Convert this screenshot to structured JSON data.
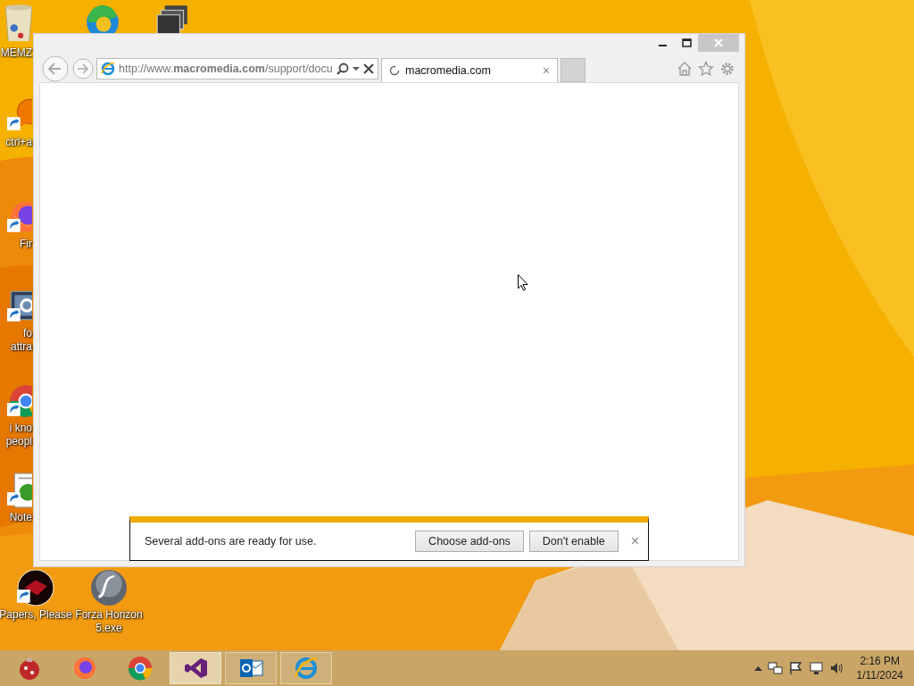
{
  "desktop_icons": [
    {
      "kind": "recycle-bin",
      "lines": [
        "MEMZ"
      ],
      "shortcut": false
    },
    {
      "kind": "edge",
      "shortcut": false
    },
    {
      "kind": "windows",
      "shortcut": false
    },
    {
      "kind": "chat",
      "lines": [
        "ctrl+a"
      ],
      "shortcut": true
    },
    {
      "kind": "firefox",
      "lines": [
        "Fir"
      ],
      "shortcut": true
    },
    {
      "kind": "settings",
      "lines": [
        "fo",
        "attra"
      ],
      "shortcut": true
    },
    {
      "kind": "chrome",
      "lines": [
        "i kno",
        "peopl"
      ],
      "shortcut": true
    },
    {
      "kind": "notepad",
      "lines": [
        "Note"
      ],
      "shortcut": true
    },
    {
      "kind": "game",
      "lines": [
        "Papers, Please"
      ],
      "shortcut": true
    },
    {
      "kind": "flash",
      "lines": [
        "Forza Horizon",
        "5.exe"
      ],
      "shortcut": false
    }
  ],
  "browser": {
    "address": "http://www.**macromedia.com**/support/docu",
    "tab": {
      "title": "macromedia.com",
      "loading": true
    },
    "notification": {
      "message": "Several add-ons are ready for use.",
      "buttons": [
        "Choose add-ons",
        "Don't enable"
      ],
      "close": "×"
    }
  },
  "taskbar": {
    "items": [
      {
        "kind": "ornament",
        "selected": false,
        "running": false
      },
      {
        "kind": "firefox",
        "selected": false,
        "running": false
      },
      {
        "kind": "chrome",
        "selected": false,
        "running": false
      },
      {
        "kind": "visual-studio",
        "selected": true,
        "running": true
      },
      {
        "kind": "outlook",
        "selected": false,
        "running": true
      },
      {
        "kind": "ie",
        "selected": false,
        "running": true
      }
    ],
    "time": "2:16 PM",
    "date": "1/11/2024"
  }
}
